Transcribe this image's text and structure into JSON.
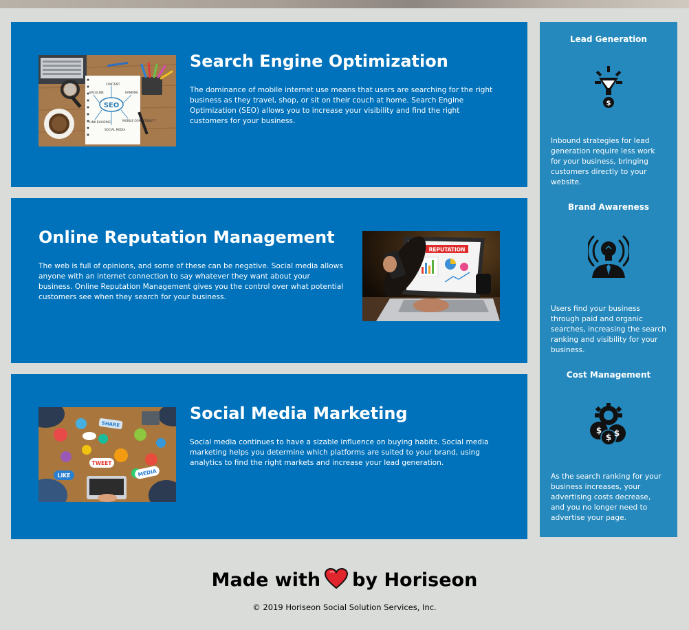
{
  "services": [
    {
      "title": "Search Engine Optimization",
      "text": "The dominance of mobile internet use means that users are searching for the right business as they travel, shop, or sit on their couch at home. Search Engine Optimization (SEO) allows you to increase your visibility and find the right customers for your business.",
      "image_words": [
        "SEO",
        "SOCIAL MEDIA",
        "LINK BUILDING",
        "BACKLINK",
        "CONTENT",
        "RANKING",
        "MOBILE COMPATIBILITY"
      ]
    },
    {
      "title": "Online Reputation Management",
      "text": "The web is full of opinions, and some of these can be negative. Social media allows anyone with an internet connection to say whatever they want about your business. Online Reputation Management gives you the control over what potential customers see when they search for your business.",
      "image_words": [
        "REPUTATION"
      ]
    },
    {
      "title": "Social Media Marketing",
      "text": "Social media continues to have a sizable influence on buying habits. Social media marketing helps you determine which platforms are suited to your brand, using analytics to find the right markets and increase your lead generation.",
      "image_words": [
        "SHARE",
        "TWEET",
        "LIKE",
        "MEDIA"
      ]
    }
  ],
  "benefits": [
    {
      "title": "Lead Generation",
      "icon": "lead-funnel-icon",
      "text": "Inbound strategies for lead generation require less work for your business, bringing customers directly to your website."
    },
    {
      "title": "Brand Awareness",
      "icon": "lightbulb-person-icon",
      "text": "Users find your business through paid and organic searches, increasing the search ranking and visibility for your business."
    },
    {
      "title": "Cost Management",
      "icon": "money-gear-icon",
      "text": "As the search ranking for your business increases, your advertising costs decrease, and you no longer need to advertise your page."
    }
  ],
  "footer": {
    "made_with": "Made with",
    "by": "by Horiseon",
    "copyright": "© 2019 Horiseon Social Solution Services, Inc."
  },
  "colors": {
    "page_background": "#d9dcd8",
    "card_blue": "#0072bb",
    "aside_blue": "#2589bd",
    "heart_red": "#e0252d"
  }
}
